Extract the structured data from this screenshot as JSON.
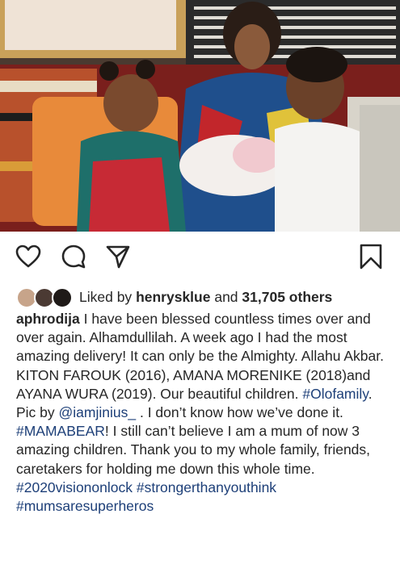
{
  "likes": {
    "prefix": "Liked by",
    "first_user": "henrysklue",
    "middle": "and",
    "count": "31,705 others"
  },
  "caption": {
    "username": "aphrodija",
    "text1": " I have been blessed countless times over and over again. Alhamdullilah. A week ago I had the most amazing delivery! It can only be the Almighty. Allahu Akbar.",
    "text2": "KITON FAROUK (2016), AMANA MORENIKE (2018)and AYANA WURA (2019). Our beautiful children. ",
    "tag_olofamily": "#Olofamily",
    "text3": ". Pic by ",
    "mention": "@iamjinius_",
    "text4": " . I don’t know how we’ve done it. ",
    "tag_mamabear": "#MAMABEAR",
    "text5": "! I still can’t believe I am a mum of now 3 amazing children. Thank you to my whole family, friends, caretakers for holding me down this whole time.",
    "tag_2020": "#2020visiononlock",
    "tag_stronger": "#strongerthanyouthink",
    "tag_mums": "#mumsaresuperheros"
  },
  "icons": {
    "like": "heart-icon",
    "comment": "comment-icon",
    "share": "share-icon",
    "save": "bookmark-icon"
  },
  "colors": {
    "text": "#262626",
    "hashtag": "#1d3f78"
  }
}
